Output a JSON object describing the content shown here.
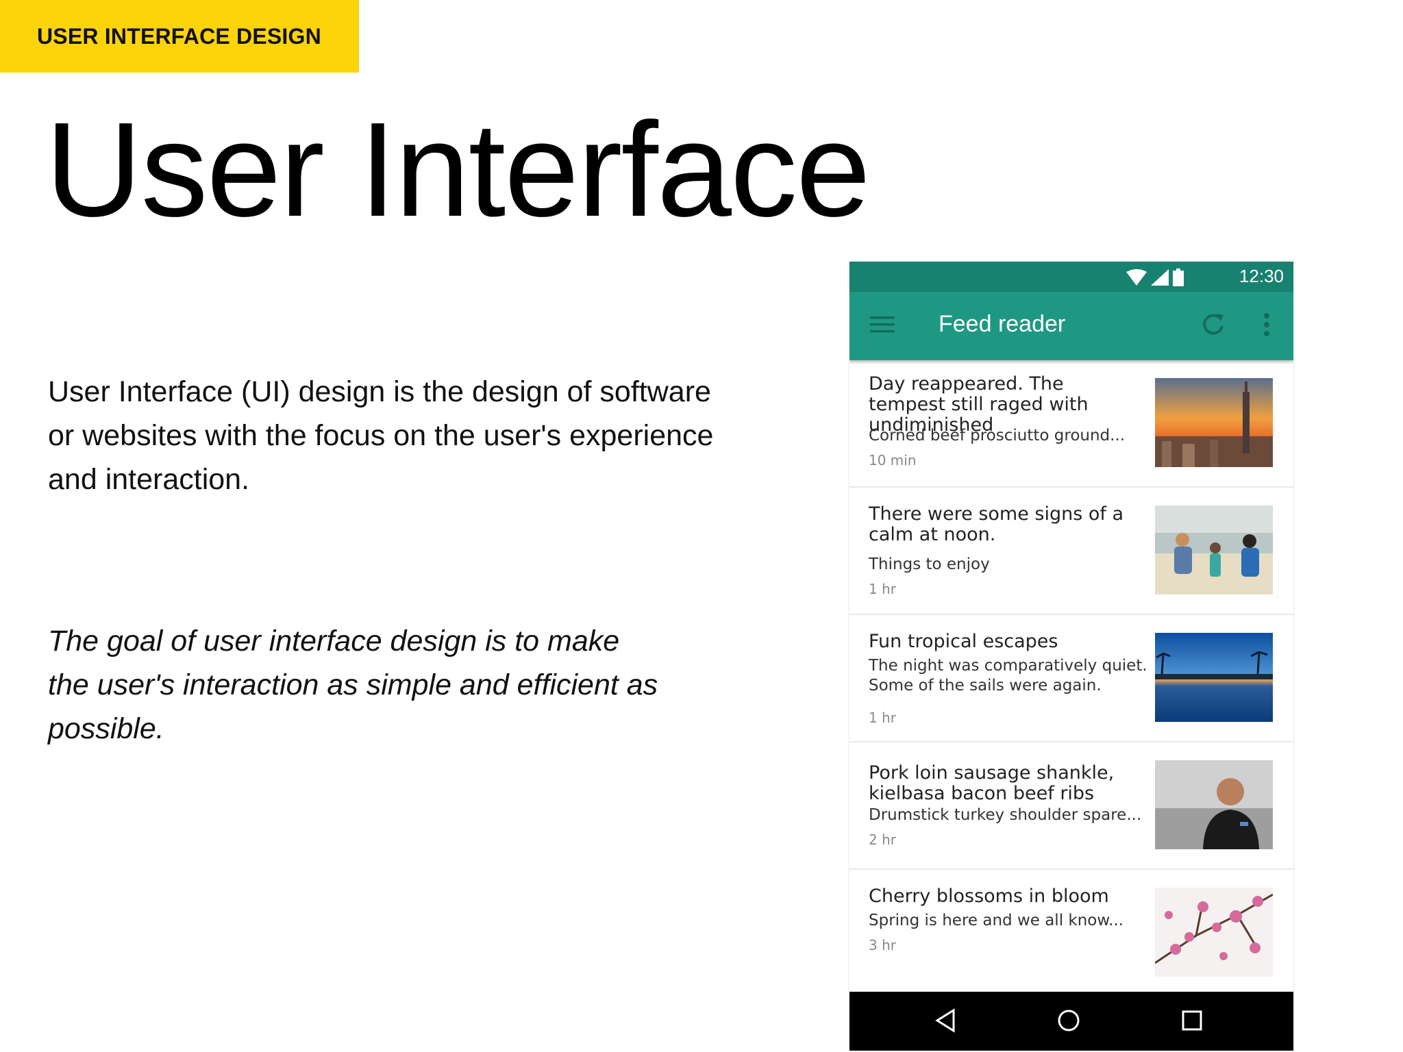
{
  "slide": {
    "tag": "USER INTERFACE DESIGN",
    "title": "User Interface",
    "paragraph": "User Interface (UI) design is the design of software or websites with the focus on the user's experience and interaction.",
    "goal": "The goal of user interface design is to make the user's interaction as simple and efficient as possible."
  },
  "phone": {
    "status": {
      "time": "12:30",
      "icons": [
        "wifi-icon",
        "signal-icon",
        "battery-icon"
      ]
    },
    "appbar": {
      "title": "Feed reader",
      "icons": [
        "menu-icon",
        "refresh-icon",
        "more-vert-icon"
      ]
    },
    "feed": [
      {
        "title": "Day reappeared. The tempest still raged with undiminished",
        "subtitle": "Corned beef prosciutto ground...",
        "meta": "10 min",
        "image": "city-skyline-sunset"
      },
      {
        "title": "There were some signs of a calm at noon.",
        "subtitle": "Things to enjoy",
        "meta": "1 hr",
        "image": "family-on-beach"
      },
      {
        "title": "Fun tropical escapes",
        "subtitle": "The night was comparatively quiet. Some of the sails were again.",
        "meta": "1 hr",
        "image": "tropical-palms-sunset"
      },
      {
        "title": "Pork loin sausage shankle, kielbasa bacon beef ribs",
        "subtitle": "Drumstick turkey shoulder spare...",
        "meta": "2 hr",
        "image": "person-portrait"
      },
      {
        "title": "Cherry blossoms in bloom",
        "subtitle": "Spring is here and we all know...",
        "meta": "3 hr",
        "image": "cherry-blossoms"
      }
    ],
    "navbar": {
      "icons": [
        "back-icon",
        "home-icon",
        "recents-icon"
      ]
    },
    "colors": {
      "statusbar": "#17826F",
      "appbar": "#1E9883",
      "tag": "#FDD30A"
    }
  }
}
